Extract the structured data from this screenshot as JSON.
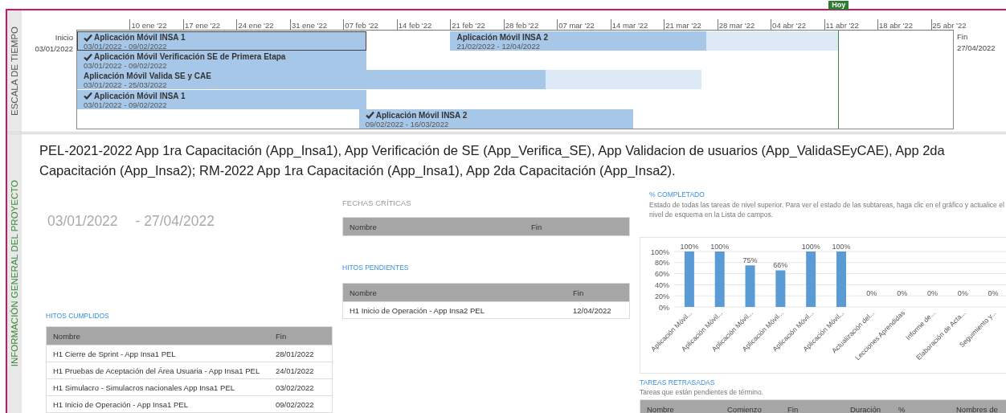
{
  "timeline": {
    "label": "ESCALA DE TIEMPO",
    "start_label": "Inicio",
    "start_date": "03/01/2022",
    "end_label": "Fin",
    "end_date": "27/04/2022",
    "today_label": "Hoy",
    "ticks": [
      "10 ene '22",
      "17 ene '22",
      "24 ene '22",
      "31 ene '22",
      "07 feb '22",
      "14 feb '22",
      "21 feb '22",
      "28 feb '22",
      "07 mar '22",
      "14 mar '22",
      "21 mar '22",
      "28 mar '22",
      "04 abr '22",
      "11 abr '22",
      "18 abr '22",
      "25 abr '22"
    ],
    "lanes": [
      {
        "bars": [
          {
            "name": "Aplicación Móvil INSA 1",
            "dates": "03/01/2022 - 09/02/2022",
            "done": true,
            "level": 1,
            "selected": true
          },
          {
            "name": "Aplicación Móvil INSA 2",
            "dates": "21/02/2022 - 12/04/2022",
            "done": false,
            "level": 0.66,
            "selected": false
          }
        ]
      },
      {
        "bars": [
          {
            "name": "Aplicación Móvil Verificación SE de Primera Etapa",
            "dates": "03/01/2022 - 09/02/2022",
            "done": true,
            "level": 1,
            "selected": false
          }
        ]
      },
      {
        "bars": [
          {
            "name": "Aplicación Móvil Valida SE y CAE",
            "dates": "03/01/2022 - 25/03/2022",
            "done": false,
            "level": 0.75,
            "selected": false
          }
        ]
      },
      {
        "bars": [
          {
            "name": "Aplicación Móvil INSA 1",
            "dates": "03/01/2022 - 09/02/2022",
            "done": true,
            "level": 1,
            "selected": false
          }
        ]
      },
      {
        "bars": [
          {
            "name": "Aplicación Móvil INSA 2",
            "dates": "09/02/2022 - 16/03/2022",
            "done": true,
            "level": 1,
            "selected": false
          }
        ]
      }
    ]
  },
  "overview": {
    "label": "INFORMACIÓN GENERAL DEL PROYECTO",
    "description": "PEL-2021-2022 App 1ra Capacitación (App_Insa1), App Verificación de SE (App_Verifica_SE), App Validacion de usuarios (App_ValidaSEyCAE), App 2da Capacitación (App_Insa2); RM-2022 App 1ra Capacitación (App_Insa1), App 2da Capacitación (App_Insa2).",
    "date_start": "03/01/2022",
    "date_end": "- 27/04/2022",
    "hitos_cumplidos": {
      "title": "HITOS CUMPLIDOS",
      "columns": [
        "Nombre",
        "Fin"
      ],
      "rows": [
        [
          "H1 Cierre de Sprint - App Insa1 PEL",
          "28/01/2022"
        ],
        [
          "H1 Pruebas de Aceptación del Área Usuaria - App Insa1 PEL",
          "24/01/2022"
        ],
        [
          "H1 Simulacro - Simulacros nacionales App Insa1 PEL",
          "03/02/2022"
        ],
        [
          "H1 Inicio de Operación - App Insa1 PEL",
          "09/02/2022"
        ]
      ]
    },
    "fechas_criticas": {
      "title": "FECHAS CRÍTICAS",
      "columns": [
        "Nombre",
        "Fin"
      ]
    },
    "hitos_pendientes": {
      "title": "HITOS PENDIENTES",
      "columns": [
        "Nombre",
        "Fin"
      ],
      "rows": [
        [
          "H1 Inicio de Operación - App Insa2 PEL",
          "12/04/2022"
        ]
      ]
    },
    "completado": {
      "title": "% COMPLETADO",
      "description": "Estado de todas las tareas de nivel superior. Para ver el estado de las subtareas, haga clic en el gráfico y actualice el nivel de esquema en la Lista de campos.",
      "chart_data": {
        "type": "bar",
        "categories": [
          "Aplicación Móvil...",
          "Aplicación Móvil...",
          "Aplicación Móvil...",
          "Aplicación Móvil...",
          "Aplicación Móvil...",
          "Aplicación Móvil...",
          "Actualización del...",
          "Lecciones Aprendidas",
          "Informe de...",
          "Elaboración de Acta...",
          "Seguimiento y..."
        ],
        "values": [
          100,
          100,
          75,
          66,
          100,
          100,
          0,
          0,
          0,
          0,
          0
        ],
        "value_labels": [
          "100%",
          "100%",
          "75%",
          "66%",
          "100%",
          "100%",
          "0%",
          "0%",
          "0%",
          "0%",
          "0%"
        ],
        "ylim": [
          0,
          100
        ],
        "grid": true,
        "yticks": [
          {
            "value": 0,
            "label": "0%"
          },
          {
            "value": 20,
            "label": "20%"
          },
          {
            "value": 40,
            "label": "40%"
          },
          {
            "value": 60,
            "label": "60%"
          },
          {
            "value": 80,
            "label": "80%"
          },
          {
            "value": 100,
            "label": "100%"
          }
        ]
      }
    },
    "tareas_retrasadas": {
      "title": "TAREAS RETRASADAS",
      "description": "Tareas que están pendientes de término.",
      "columns": [
        "Nombre",
        "Comienzo",
        "Fin",
        "Duración",
        "%",
        "Nombres de"
      ]
    }
  }
}
